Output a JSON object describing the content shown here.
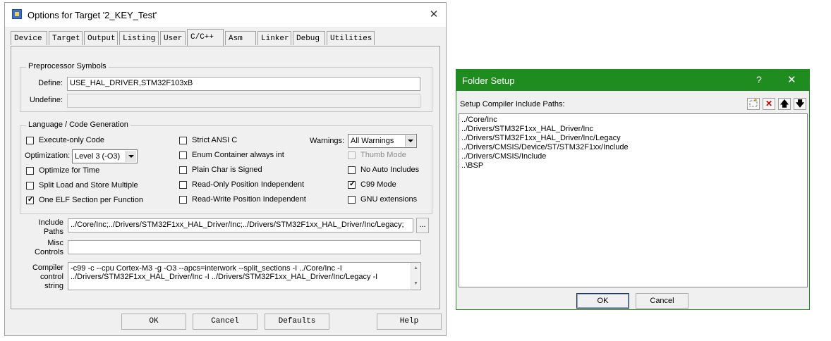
{
  "options_dialog": {
    "title": "Options for Target '2_KEY_Test'",
    "close_glyph": "✕",
    "tabs": [
      "Device",
      "Target",
      "Output",
      "Listing",
      "User",
      "C/C++",
      "Asm",
      "Linker",
      "Debug",
      "Utilities"
    ],
    "active_tab": "C/C++",
    "preprocessor": {
      "legend": "Preprocessor Symbols",
      "define_label": "Define:",
      "define_value": "USE_HAL_DRIVER,STM32F103xB",
      "undefine_label": "Undefine:",
      "undefine_value": ""
    },
    "language": {
      "legend": "Language / Code Generation",
      "execute_only": {
        "label": "Execute-only Code",
        "checked": false
      },
      "optimization_label": "Optimization:",
      "optimization_value": "Level 3 (-O3)",
      "optimize_time": {
        "label": "Optimize for Time",
        "checked": false
      },
      "split_load": {
        "label": "Split Load and Store Multiple",
        "checked": false
      },
      "one_elf": {
        "label": "One ELF Section per Function",
        "checked": true
      },
      "strict_ansi": {
        "label": "Strict ANSI C",
        "checked": false
      },
      "enum_container": {
        "label": "Enum Container always int",
        "checked": false
      },
      "plain_char": {
        "label": "Plain Char is Signed",
        "checked": false
      },
      "ro_pi": {
        "label": "Read-Only Position Independent",
        "checked": false
      },
      "rw_pi": {
        "label": "Read-Write Position Independent",
        "checked": false
      },
      "warnings_label": "Warnings:",
      "warnings_value": "All Warnings",
      "thumb_mode": {
        "label": "Thumb Mode",
        "checked": false,
        "disabled": true
      },
      "no_auto_includes": {
        "label": "No Auto Includes",
        "checked": false
      },
      "c99_mode": {
        "label": "C99 Mode",
        "checked": true
      },
      "gnu_ext": {
        "label": "GNU extensions",
        "checked": false
      }
    },
    "include_paths": {
      "label_line1": "Include",
      "label_line2": "Paths",
      "value": "../Core/Inc;../Drivers/STM32F1xx_HAL_Driver/Inc;../Drivers/STM32F1xx_HAL_Driver/Inc/Legacy;",
      "browse_label": "..."
    },
    "misc_controls": {
      "label_line1": "Misc",
      "label_line2": "Controls",
      "value": ""
    },
    "compiler_control": {
      "label_line1": "Compiler",
      "label_line2": "control",
      "label_line3": "string",
      "line1": "-c99 -c --cpu Cortex-M3 -g -O3 --apcs=interwork --split_sections -I ../Core/Inc -I",
      "line2": "../Drivers/STM32F1xx_HAL_Driver/Inc -I ../Drivers/STM32F1xx_HAL_Driver/Inc/Legacy -I"
    },
    "buttons": {
      "ok": "OK",
      "cancel": "Cancel",
      "defaults": "Defaults",
      "help": "Help"
    }
  },
  "folder_dialog": {
    "title": "Folder Setup",
    "help_glyph": "?",
    "close_glyph": "✕",
    "header_label": "Setup Compiler Include Paths:",
    "toolbar_icons": [
      "new-folder-icon",
      "delete-icon",
      "move-up-icon",
      "move-down-icon"
    ],
    "paths": [
      "../Core/Inc",
      "../Drivers/STM32F1xx_HAL_Driver/Inc",
      "../Drivers/STM32F1xx_HAL_Driver/Inc/Legacy",
      "../Drivers/CMSIS/Device/ST/STM32F1xx/Include",
      "../Drivers/CMSIS/Include",
      "..\\BSP"
    ],
    "buttons": {
      "ok": "OK",
      "cancel": "Cancel"
    }
  },
  "colors": {
    "folder_titlebar": "#1e8c1e",
    "dialog_bg": "#f0f0f0"
  }
}
